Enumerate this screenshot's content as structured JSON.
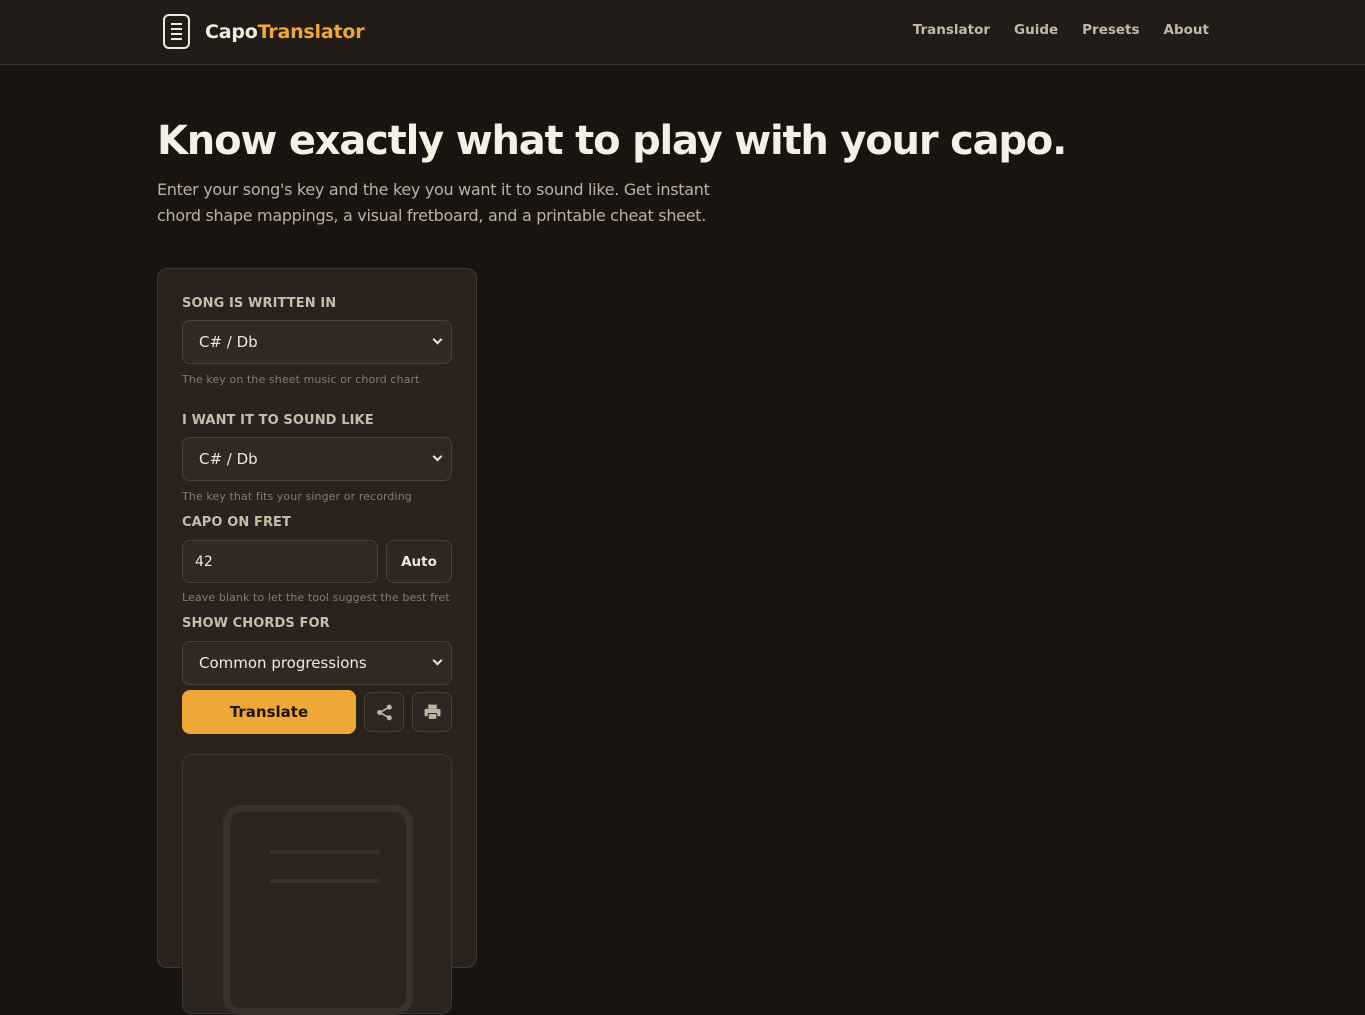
{
  "brand": {
    "part1": "Capo",
    "part2": "Translator",
    "icon": "document-list-icon"
  },
  "nav": {
    "items": [
      "Translator",
      "Guide",
      "Presets",
      "About"
    ]
  },
  "hero": {
    "title": "Know exactly what to play with your capo.",
    "subtitle": "Enter your song's key and the key you want it to sound like. Get instant chord shape mappings, a visual fretboard, and a printable cheat sheet."
  },
  "form": {
    "written_label": "SONG IS WRITTEN IN",
    "written_value": "C# / Db",
    "written_hint": "The key on the sheet music or chord chart",
    "sound_label": "I WANT IT TO SOUND LIKE",
    "sound_value": "C# / Db",
    "sound_hint": "The key that fits your singer or recording",
    "capo_label": "CAPO ON FRET",
    "capo_value": "42",
    "auto_label": "Auto",
    "capo_hint": "Leave blank to let the tool suggest the best fret",
    "chords_label": "SHOW CHORDS FOR",
    "chords_value": "Common progressions",
    "translate_label": "Translate",
    "share_icon": "share-icon",
    "print_icon": "printer-icon"
  },
  "colors": {
    "accent": "#eea836",
    "background": "#1a1411",
    "card": "#2a221d"
  }
}
